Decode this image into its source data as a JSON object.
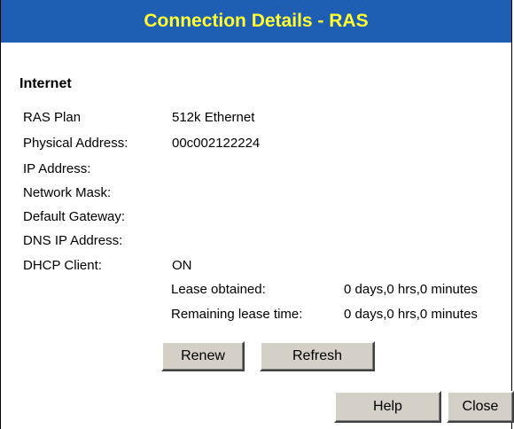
{
  "header": {
    "title": "Connection Details - RAS"
  },
  "section": {
    "heading": "Internet"
  },
  "details": {
    "ras_plan": {
      "label": "RAS Plan",
      "value": "512k Ethernet"
    },
    "physical_address": {
      "label": "Physical Address:",
      "value": "00c002122224"
    },
    "ip_address": {
      "label": "IP Address:",
      "value": ""
    },
    "network_mask": {
      "label": "Network Mask:",
      "value": ""
    },
    "default_gateway": {
      "label": "Default Gateway:",
      "value": ""
    },
    "dns_ip_address": {
      "label": "DNS IP Address:",
      "value": ""
    },
    "dhcp_client": {
      "label": "DHCP Client:",
      "value": "ON"
    },
    "lease_obtained": {
      "label": "Lease obtained:",
      "value": "0 days,0 hrs,0 minutes"
    },
    "remaining_lease": {
      "label": "Remaining lease time:",
      "value": "0 days,0 hrs,0 minutes"
    }
  },
  "buttons": {
    "renew": "Renew",
    "refresh": "Refresh",
    "help": "Help",
    "close": "Close"
  },
  "colors": {
    "title_bar_bg": "#1e5fb3",
    "title_text": "#ffff33",
    "button_face": "#d4d0c8"
  }
}
